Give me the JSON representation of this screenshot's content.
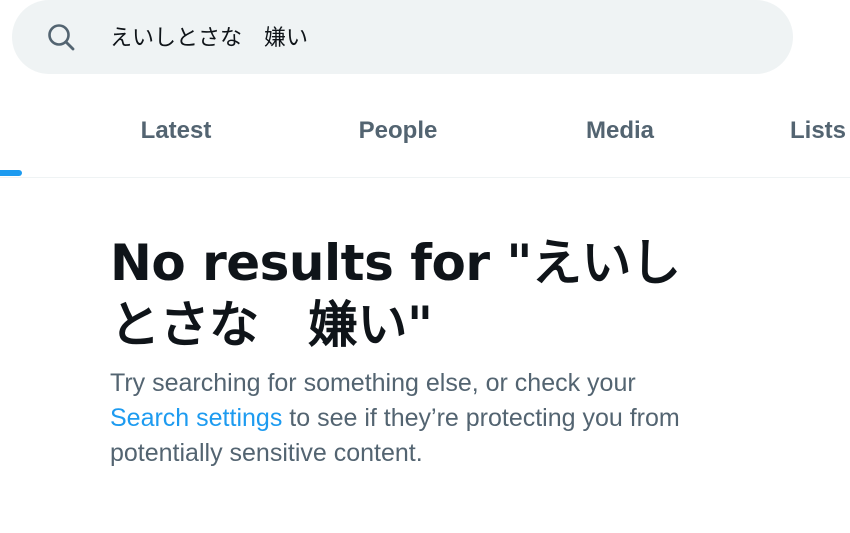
{
  "search": {
    "query": "えいしとさな　嫌い",
    "icon": "search-icon"
  },
  "tabs": [
    {
      "label": "Latest"
    },
    {
      "label": "People"
    },
    {
      "label": "Media"
    },
    {
      "label": "Lists"
    }
  ],
  "empty_state": {
    "title": "No results for \"えいしとさな　嫌い\"",
    "desc_before": "Try searching for something else, or check your ",
    "link": "Search settings",
    "desc_after": " to see if they’re protecting you from potentially sensitive content."
  },
  "colors": {
    "accent": "#1d9bf0",
    "text_primary": "#0f1419",
    "text_secondary": "#536471",
    "search_bg": "#eff3f4"
  }
}
